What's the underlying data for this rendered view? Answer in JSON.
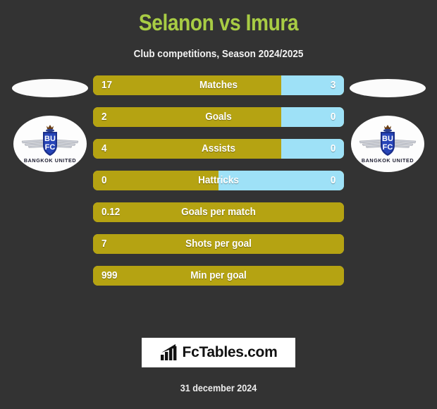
{
  "header": {
    "title": "Selanon vs Imura",
    "subtitle": "Club competitions, Season 2024/2025",
    "title_color": "#a8cc44"
  },
  "colors": {
    "background": "#333333",
    "bar_left": "#b5a312",
    "bar_right": "#9ee1f7",
    "title": "#a8cc44",
    "text": "#ffffff"
  },
  "players": {
    "left": {
      "name": "Selanon",
      "club": "BANGKOK UNITED",
      "crest_initials_top": "BU",
      "crest_initials_bottom": "FC",
      "photo_icon": "player-photo-placeholder"
    },
    "right": {
      "name": "Imura",
      "club": "BANGKOK UNITED",
      "crest_initials_top": "BU",
      "crest_initials_bottom": "FC",
      "photo_icon": "player-photo-placeholder"
    }
  },
  "stats": [
    {
      "label": "Matches",
      "left": "17",
      "right": "3",
      "left_pct": 75,
      "has_right": true
    },
    {
      "label": "Goals",
      "left": "2",
      "right": "0",
      "left_pct": 75,
      "has_right": true
    },
    {
      "label": "Assists",
      "left": "4",
      "right": "0",
      "left_pct": 75,
      "has_right": true
    },
    {
      "label": "Hattricks",
      "left": "0",
      "right": "0",
      "left_pct": 50,
      "has_right": true
    },
    {
      "label": "Goals per match",
      "left": "0.12",
      "right": "",
      "left_pct": 100,
      "has_right": false
    },
    {
      "label": "Shots per goal",
      "left": "7",
      "right": "",
      "left_pct": 100,
      "has_right": false
    },
    {
      "label": "Min per goal",
      "left": "999",
      "right": "",
      "left_pct": 100,
      "has_right": false
    }
  ],
  "footer": {
    "logo_text": "FcTables.com",
    "logo_icon": "bar-chart-arrow-icon",
    "date": "31 december 2024"
  }
}
